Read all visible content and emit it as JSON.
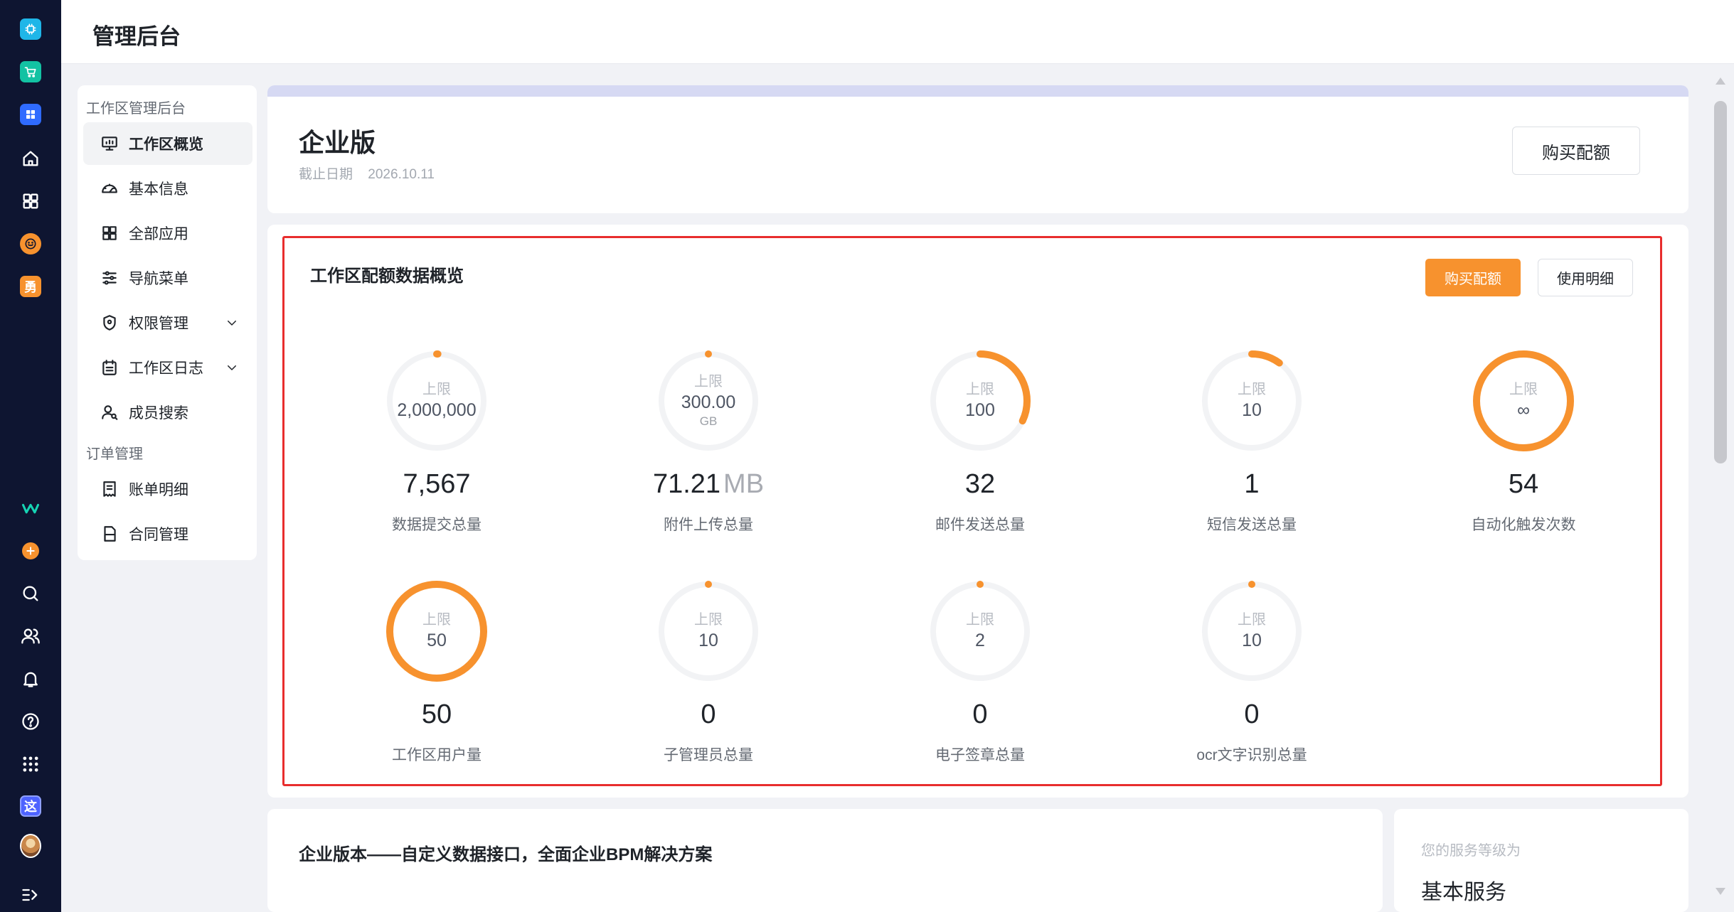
{
  "header": {
    "title": "管理后台"
  },
  "rail": {
    "bottom_apps": [
      {
        "icon": "wecom-logo-icon"
      },
      {
        "icon": "add-circle-icon"
      },
      {
        "icon": "search-icon"
      },
      {
        "icon": "members-icon"
      },
      {
        "icon": "bell-icon"
      },
      {
        "icon": "help-circle-icon"
      },
      {
        "icon": "grid-apps-icon"
      },
      {
        "icon": "app-zhe-icon",
        "label": "这"
      },
      {
        "icon": "user-avatar-icon"
      },
      {
        "icon": "expand-sidebar-icon"
      }
    ],
    "top_apps": [
      {
        "icon": "chip-app-icon",
        "color": "#1fb6e8"
      },
      {
        "icon": "cart-app-icon",
        "color": "#13c2a3"
      },
      {
        "icon": "grid-app-icon",
        "color": "#2f6bff"
      },
      {
        "icon": "home-icon"
      },
      {
        "icon": "all-apps-icon"
      },
      {
        "icon": "smile-app-icon",
        "color": "#f7922e"
      },
      {
        "icon": "yong-app-icon",
        "color": "#f7922e",
        "label": "勇"
      }
    ]
  },
  "nav": {
    "group_workspace": "工作区管理后台",
    "group_orders": "订单管理",
    "items": [
      {
        "label": "工作区概览",
        "icon": "monitor-icon",
        "active": true
      },
      {
        "label": "基本信息",
        "icon": "dashboard-icon"
      },
      {
        "label": "全部应用",
        "icon": "apps-grid-icon"
      },
      {
        "label": "导航菜单",
        "icon": "sliders-icon"
      },
      {
        "label": "权限管理",
        "icon": "shield-icon",
        "expandable": true
      },
      {
        "label": "工作区日志",
        "icon": "calendar-icon",
        "expandable": true
      },
      {
        "label": "成员搜索",
        "icon": "user-search-icon"
      },
      {
        "label": "账单明细",
        "icon": "bill-icon"
      },
      {
        "label": "合同管理",
        "icon": "contract-icon"
      }
    ]
  },
  "edition": {
    "title": "企业版",
    "expiry_label": "截止日期",
    "expiry_date": "2026.10.11",
    "buy_label": "购买配额"
  },
  "quota": {
    "title": "工作区配额数据概览",
    "buy_label": "购买配额",
    "detail_label": "使用明细",
    "limit_label": "上限",
    "metrics": [
      {
        "name": "数据提交总量",
        "limit": "2,000,000",
        "limit_unit": "",
        "value": "7,567",
        "value_unit": "",
        "ratio": 0.004
      },
      {
        "name": "附件上传总量",
        "limit": "300.00",
        "limit_unit": "GB",
        "value": "71.21",
        "value_unit": "MB",
        "ratio": 0.0
      },
      {
        "name": "邮件发送总量",
        "limit": "100",
        "limit_unit": "",
        "value": "32",
        "value_unit": "",
        "ratio": 0.32
      },
      {
        "name": "短信发送总量",
        "limit": "10",
        "limit_unit": "",
        "value": "1",
        "value_unit": "",
        "ratio": 0.1
      },
      {
        "name": "自动化触发次数",
        "limit": "∞",
        "limit_unit": "",
        "value": "54",
        "value_unit": "",
        "ratio": 1.0
      },
      {
        "name": "工作区用户量",
        "limit": "50",
        "limit_unit": "",
        "value": "50",
        "value_unit": "",
        "ratio": 1.0
      },
      {
        "name": "子管理员总量",
        "limit": "10",
        "limit_unit": "",
        "value": "0",
        "value_unit": "",
        "ratio": 0.0
      },
      {
        "name": "电子签章总量",
        "limit": "2",
        "limit_unit": "",
        "value": "0",
        "value_unit": "",
        "ratio": 0.0
      },
      {
        "name": "ocr文字识别总量",
        "limit": "10",
        "limit_unit": "",
        "value": "0",
        "value_unit": "",
        "ratio": 0.0
      }
    ],
    "ring_color": "#f7922e",
    "track_color": "#f2f3f5"
  },
  "bottom": {
    "solution_title": "企业版本——自定义数据接口，全面企业BPM解决方案",
    "service_label": "您的服务等级为",
    "service_value": "基本服务"
  }
}
